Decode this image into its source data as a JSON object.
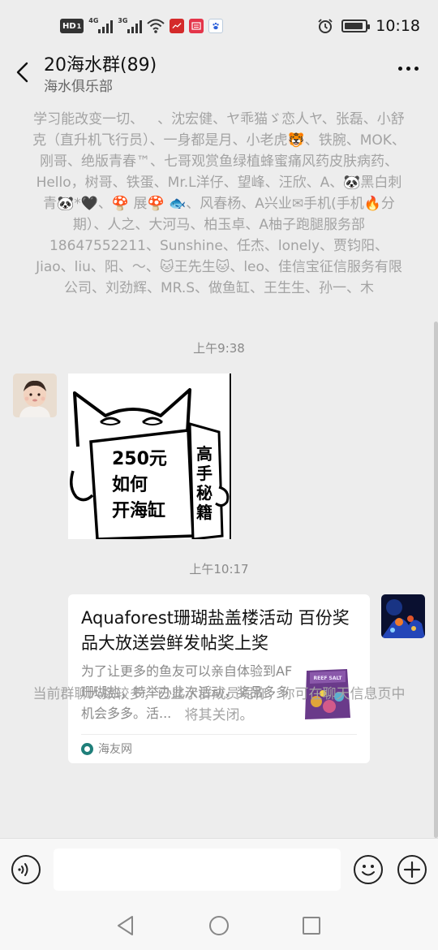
{
  "status_bar": {
    "hd": "HD",
    "sim1": "1",
    "net1": "4G",
    "net2": "3G",
    "time": "10:18",
    "battery_level": 0.9
  },
  "header": {
    "title": "20海水群(89)",
    "subtitle": "海水俱乐部"
  },
  "chat": {
    "member_names": "学习能改变一切、 、沈宏健、ヤ乖猫ゞ恋人ヤ、张磊、小舒克（直升机飞行员）、一身都是月、小老虎🐯、铁腕、MOK、刚哥、绝版青春™、七哥观赏鱼绿植蜂蜜痛风药皮肤病药、Hello，树哥、铁蛋、Mr.L洋仔、望峰、汪欣、A、🐼黑白刺青🐼*🖤、🍄 展🍄 🐟、风春杨、A兴业✉手机(手机🔥分期）、人之、大河马、柏玉卓、A柚子跑腿服务部18647552211、Sunshine、任杰、lonely、贾钧阳、Jiao、liu、阳、～、🐱王先生🐱、leo、佳信宝征信服务有限公司、刘劲辉、MR.S、做鱼缸、王生生、孙一、木",
    "timestamps": [
      "上午9:38",
      "上午10:17"
    ],
    "sticker": {
      "left_sign": [
        "250元",
        "如何",
        "开海缸"
      ],
      "right_sign": [
        "高",
        "手",
        "秘",
        "籍"
      ]
    },
    "link_card": {
      "title": "Aquaforest珊瑚盐盖楼活动 百份奖品大放送尝鲜发帖奖上奖",
      "description": "为了让更多的鱼友可以亲自体验到AF珊瑚盐，特举办此次活动，奖品多多机会多多。活...",
      "source": "海友网",
      "thumb_label": "REEF SALT"
    },
    "notice": "当前群聊人数较多，已显示群成员昵称，你可在聊天信息页中将其关闭。"
  },
  "colors": {
    "background": "#ededed",
    "system_text": "#a3a3a3",
    "bubble": "#ffffff",
    "source_icon": "#1f7f7a"
  }
}
